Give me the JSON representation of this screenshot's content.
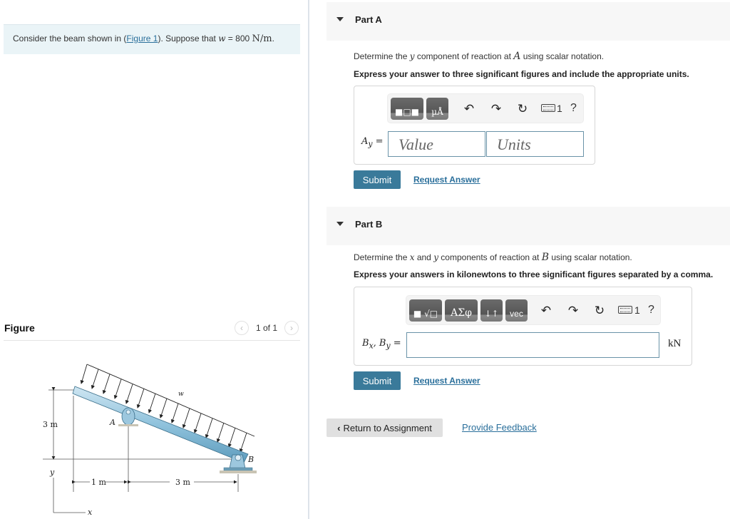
{
  "intro": {
    "prefix": "Consider the beam shown in (",
    "figure_link": "Figure 1",
    "suffix": "). Suppose that ",
    "var": "w",
    "equals": " = 800 ",
    "unit": "N/m",
    "period": "."
  },
  "figure": {
    "title": "Figure",
    "counter": "1 of 1",
    "prev_icon": "chevron-left",
    "next_icon": "chevron-right",
    "labels": {
      "height": "3 m",
      "dist_a": "1 m",
      "dist_b": "3 m",
      "load": "w",
      "support_a": "A",
      "support_b": "B",
      "axis_x": "x",
      "axis_y": "y"
    }
  },
  "part_a": {
    "title": "Part A",
    "question_pre": "Determine the ",
    "question_var": "y",
    "question_mid": " component of reaction at ",
    "question_point": "A",
    "question_post": "  using scalar notation.",
    "instruction": "Express your answer to three significant figures and include the appropriate units.",
    "label_var": "A",
    "label_sub": "y",
    "label_eq": " =",
    "value_placeholder": "Value",
    "units_placeholder": "Units",
    "keyboard_count": "1",
    "help": "?",
    "submit": "Submit",
    "request_answer": "Request Answer"
  },
  "part_b": {
    "title": "Part B",
    "question_pre": "Determine the ",
    "question_var1": "x",
    "question_and": " and ",
    "question_var2": "y",
    "question_mid": " components of reaction at ",
    "question_point": "B",
    "question_post": " using scalar notation.",
    "instruction": "Express your answers in kilonewtons to three significant figures separated by a comma.",
    "label": "B",
    "label_sub1": "x",
    "label_sep": ", B",
    "label_sub2": "y",
    "label_eq": " =",
    "answer_value": "",
    "unit": "kN",
    "greek_button": "ΑΣφ",
    "vec_button": "vec",
    "keyboard_count": "1",
    "help": "?",
    "submit": "Submit",
    "request_answer": "Request Answer"
  },
  "footer": {
    "return_label": "Return to Assignment",
    "feedback_label": "Provide Feedback"
  }
}
